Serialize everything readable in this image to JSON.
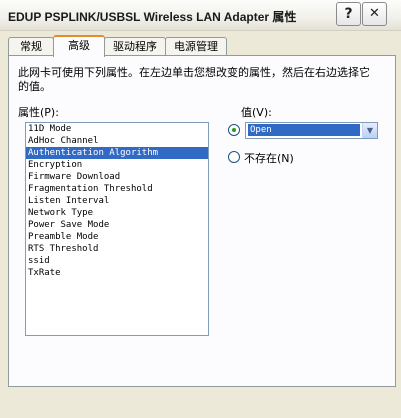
{
  "window": {
    "title": "EDUP PSPLINK/USBSL Wireless LAN Adapter 属性",
    "help_button": "?",
    "close_button": "✕"
  },
  "tabs": [
    {
      "label": "常规"
    },
    {
      "label": "高级"
    },
    {
      "label": "驱动程序"
    },
    {
      "label": "电源管理"
    }
  ],
  "panel": {
    "description": "此网卡可使用下列属性。在左边单击您想改变的属性，然后在右边选择它的值。",
    "property_label": "属性(P):",
    "value_label": "值(V):",
    "properties": [
      "11D Mode",
      "AdHoc Channel",
      "Authentication Algorithm",
      "Encryption",
      "Firmware Download",
      "Fragmentation Threshold",
      "Listen Interval",
      "Network Type",
      "Power Save Mode",
      "Preamble Mode",
      "RTS Threshold",
      "ssid",
      "TxRate"
    ],
    "selected_property": "Authentication Algorithm",
    "value_selected": "Open",
    "not_present_label": "不存在(N)"
  }
}
